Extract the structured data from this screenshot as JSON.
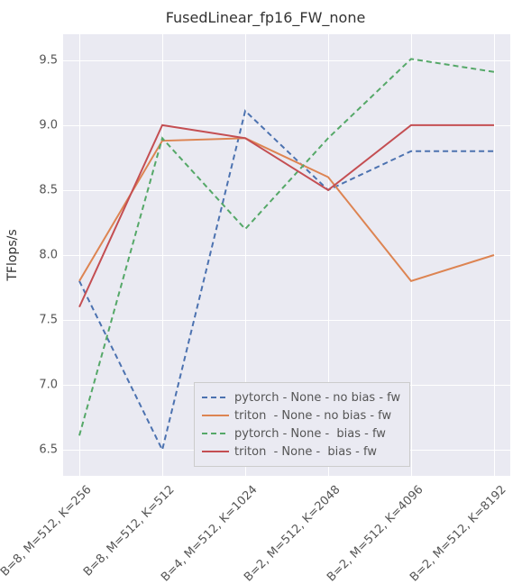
{
  "chart_data": {
    "type": "line",
    "title": "FusedLinear_fp16_FW_none",
    "xlabel": "",
    "ylabel": "TFlops/s",
    "ylim": [
      6.3,
      9.7
    ],
    "yticks": [
      6.5,
      7.0,
      7.5,
      8.0,
      8.5,
      9.0,
      9.5
    ],
    "categories": [
      "B=8, M=512, K=256",
      "B=8, M=512, K=512",
      "B=4, M=512, K=1024",
      "B=2, M=512, K=2048",
      "B=2, M=512, K=4096",
      "B=2, M=512, K=8192"
    ],
    "series": [
      {
        "name": "pytorch - None - no bias - fw",
        "color": "#4c72b0",
        "dash": "6,4",
        "values": [
          7.8,
          6.5,
          9.11,
          8.5,
          8.8,
          8.8
        ]
      },
      {
        "name": "triton  - None - no bias - fw",
        "color": "#dd8452",
        "dash": "",
        "values": [
          7.8,
          8.88,
          8.9,
          8.6,
          7.8,
          8.0
        ]
      },
      {
        "name": "pytorch - None -  bias - fw",
        "color": "#55a868",
        "dash": "6,4",
        "values": [
          6.61,
          8.9,
          8.2,
          8.9,
          9.51,
          9.41
        ]
      },
      {
        "name": "triton  - None -  bias - fw",
        "color": "#c44e52",
        "dash": "",
        "values": [
          7.6,
          9.0,
          8.9,
          8.5,
          9.0,
          9.0
        ]
      }
    ],
    "legend_position": "inside-bottom-center"
  }
}
